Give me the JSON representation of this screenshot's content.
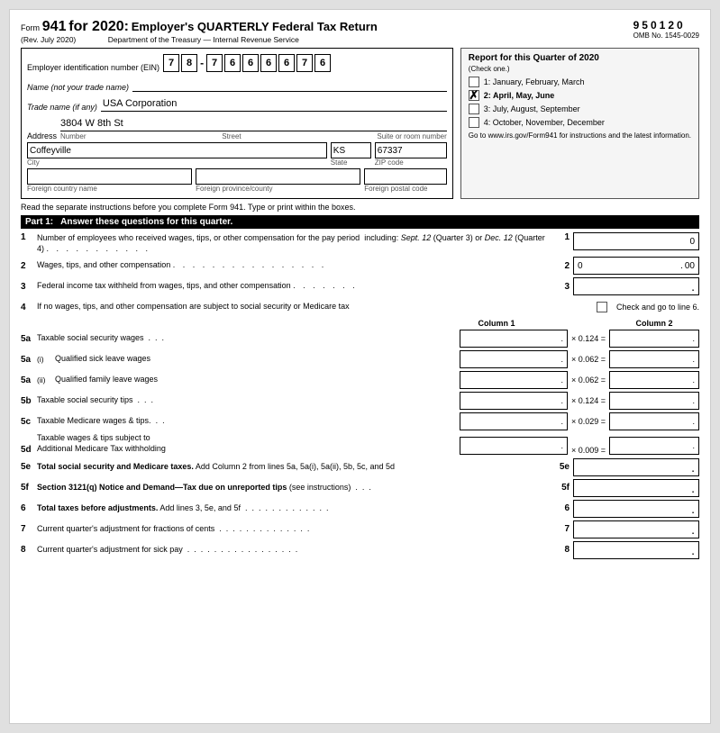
{
  "header": {
    "form_label": "Form",
    "form_number": "941",
    "form_year": "for 2020:",
    "form_subtitle": "Employer's QUARTERLY Federal Tax Return",
    "rev_date": "(Rev. July 2020)",
    "dept_line": "Department of the Treasury — Internal Revenue Service",
    "omb_number": "950120",
    "omb_label": "OMB No. 1545-0029"
  },
  "quarter_box": {
    "title": "Report for this Quarter of 2020",
    "check_note": "(Check one.)",
    "quarters": [
      {
        "id": 1,
        "label": "1: January, February, March",
        "checked": false
      },
      {
        "id": 2,
        "label": "2: April, May, June",
        "checked": true
      },
      {
        "id": 3,
        "label": "3: July, August, September",
        "checked": false
      },
      {
        "id": 4,
        "label": "4: October, November, December",
        "checked": false
      }
    ],
    "link_text": "Go to www.irs.gov/Form941 for instructions and the latest information."
  },
  "employer": {
    "ein_label": "Employer identification number (EIN)",
    "ein_digits": [
      "7",
      "8",
      "7",
      "6",
      "6",
      "6",
      "6",
      "7",
      "6"
    ],
    "name_label": "Name (not your trade name)",
    "name_value": "",
    "trade_name_label": "Trade name (if any)",
    "trade_name_value": "USA Corporation",
    "address_label": "Address",
    "address_number": "3804 W 8th St",
    "address_sub_labels": [
      "Number",
      "Street",
      "Suite or room number"
    ],
    "city_value": "Coffeyville",
    "state_value": "KS",
    "zip_value": "67337",
    "city_label": "City",
    "state_label": "State",
    "zip_label": "ZIP code",
    "foreign_country_label": "Foreign country name",
    "foreign_province_label": "Foreign province/county",
    "foreign_postal_label": "Foreign postal code"
  },
  "instructions_line": "Read the separate instructions before you complete Form 941. Type or print within the boxes.",
  "part1": {
    "header_num": "Part 1:",
    "header_desc": "Answer these questions for this quarter.",
    "lines": [
      {
        "num": "1",
        "desc": "Number of employees who received wages, tips, or other compensation for the pay period  including: Sept. 12 (Quarter 3) or Dec. 12 (Quarter 4)",
        "dots": true,
        "ref": "1",
        "value": "0",
        "type": "single"
      },
      {
        "num": "2",
        "desc": "Wages, tips, and other compensation",
        "dots": true,
        "ref": "2",
        "value": "0",
        "cents": "00",
        "type": "cents"
      },
      {
        "num": "3",
        "desc": "Federal income tax withheld from wages, tips, and other compensation",
        "dots": true,
        "ref": "3",
        "value": "",
        "type": "single_dot"
      }
    ],
    "line4": {
      "num": "4",
      "desc": "If no wages, tips, and other compensation are subject to social security or Medicare tax",
      "dots": false,
      "checkbox_label": "Check and go to line 6."
    },
    "col_headers": {
      "col1": "Column 1",
      "col2": "Column 2"
    },
    "two_col_lines": [
      {
        "num": "5a",
        "sub": "",
        "desc": "Taxable social security wages . . .",
        "multiplier": "× 0.124 =",
        "type": "twocol"
      },
      {
        "num": "5a",
        "sub": "(i)",
        "desc": "Qualified sick leave wages",
        "multiplier": "× 0.062 =",
        "type": "twocol"
      },
      {
        "num": "5a",
        "sub": "(ii)",
        "desc": "Qualified family leave wages",
        "multiplier": "× 0.062 =",
        "type": "twocol"
      },
      {
        "num": "5b",
        "sub": "",
        "desc": "Taxable social security tips . . .",
        "multiplier": "× 0.124 =",
        "type": "twocol"
      },
      {
        "num": "5c",
        "sub": "",
        "desc": "Taxable Medicare wages & tips. . .",
        "multiplier": "× 0.029 =",
        "type": "twocol"
      },
      {
        "num": "5d",
        "sub": "",
        "desc": "Taxable wages & tips subject to\nAdditional Medicare Tax withholding",
        "multiplier": "× 0.009 =",
        "type": "twocol"
      }
    ],
    "lines_lower": [
      {
        "num": "5e",
        "desc": "Total social security and Medicare taxes. Add Column 2 from lines 5a, 5a(i), 5a(ii), 5b, 5c, and 5d",
        "ref": "5e",
        "type": "single_dot"
      },
      {
        "num": "5f",
        "desc": "Section 3121(q) Notice and Demand—Tax due on unreported tips (see instructions)  . . .",
        "ref": "5f",
        "type": "single_dot"
      },
      {
        "num": "6",
        "desc": "Total taxes before adjustments. Add lines 3, 5e, and 5f  . . . . . . . . . . . . .",
        "ref": "6",
        "type": "single_dot"
      },
      {
        "num": "7",
        "desc": "Current quarter's adjustment for fractions of cents  . . . . . . . . . . . . . . .",
        "ref": "7",
        "type": "single_dot"
      },
      {
        "num": "8",
        "desc": "Current quarter's adjustment for sick pay  . . . . . . . . . . . . . . . . . . .",
        "ref": "8",
        "type": "single_dot"
      }
    ]
  }
}
